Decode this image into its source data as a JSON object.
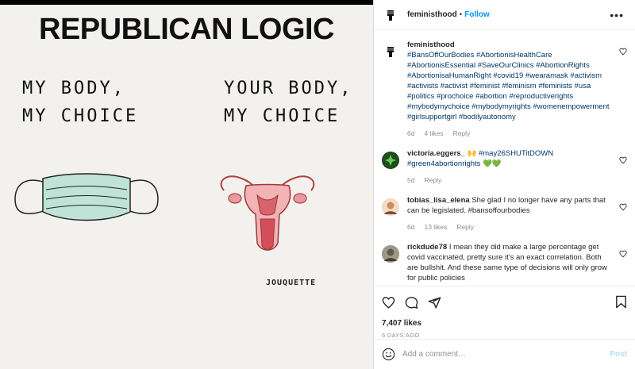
{
  "image": {
    "title": "REPUBLICAN LOGIC",
    "left_text_line1": "MY BODY,",
    "left_text_line2": "MY CHOICE",
    "right_text_line1": "YOUR BODY,",
    "right_text_line2": "MY CHOICE",
    "signature": "JOUQUETTE"
  },
  "header": {
    "username": "feministhood",
    "separator": "•",
    "follow_label": "Follow",
    "more_label": "•••"
  },
  "comments": [
    {
      "username": "feministhood",
      "text": "#BansOffOurBodies #AbortionisHealthCare #AbortionisEssential #SaveOurClinics #AbortionRights #AbortionisaHumanRight #covid19 #wearamask #activism #activists #activist #feminist #feminism #feminists #usa #politics #prochoice #abortion #reproductiverights #mybodymychoice #mybodymyrights #womenempowerment #girlsupportgirl #bodilyautonomy",
      "time": "6d",
      "likes": "4 likes",
      "reply": "Reply"
    },
    {
      "username": "victoria.eggers_",
      "text": "🙌 #may26SHUTitDOWN #green4abortionrights 💚💚",
      "time": "5d",
      "likes": "",
      "reply": "Reply"
    },
    {
      "username": "tobias_lisa_elena",
      "text": "She glad I no longer have any parts that can be legislated. #bansoffourbodies",
      "time": "6d",
      "likes": "13 likes",
      "reply": "Reply"
    },
    {
      "username": "rickdude78",
      "text": "I mean they did make a large percentage get covid vaccinated, pretty sure it's an exact correlation. Both are bullshit. And these same type of decisions will only grow for public policies",
      "time": "",
      "likes": "",
      "reply": ""
    }
  ],
  "actions": {
    "likes": "7,407 likes",
    "time_ago": "6 DAYS AGO"
  },
  "add_comment": {
    "placeholder": "Add a comment…",
    "post_label": "Post"
  },
  "colors": {
    "link_blue": "#0095f6",
    "hashtag": "#00376b",
    "muted": "#8e8e8e"
  }
}
